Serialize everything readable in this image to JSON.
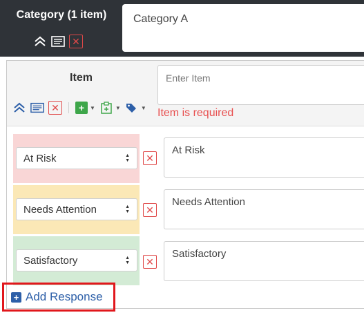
{
  "category": {
    "title": "Category (1 item)",
    "name_value": "Category A"
  },
  "item": {
    "title": "Item",
    "placeholder": "Enter Item",
    "error": "Item is required"
  },
  "responses": [
    {
      "select_value": "At Risk",
      "text": "At Risk",
      "color": "#f9d6d6"
    },
    {
      "select_value": "Needs Attention",
      "text": "Needs Attention",
      "color": "#fbe8b6"
    },
    {
      "select_value": "Satisfactory",
      "text": "Satisfactory",
      "color": "#d3ebd5"
    }
  ],
  "add_response": {
    "label": "Add Response"
  },
  "colors": {
    "accent": "#2d5fa8",
    "error": "#e84f4f",
    "header_bg": "#2f3338",
    "highlight": "#e1171c"
  },
  "icons": [
    "collapse-icon",
    "notes-icon",
    "delete-icon",
    "add-icon",
    "clipboard-plus-icon",
    "tags-icon"
  ]
}
